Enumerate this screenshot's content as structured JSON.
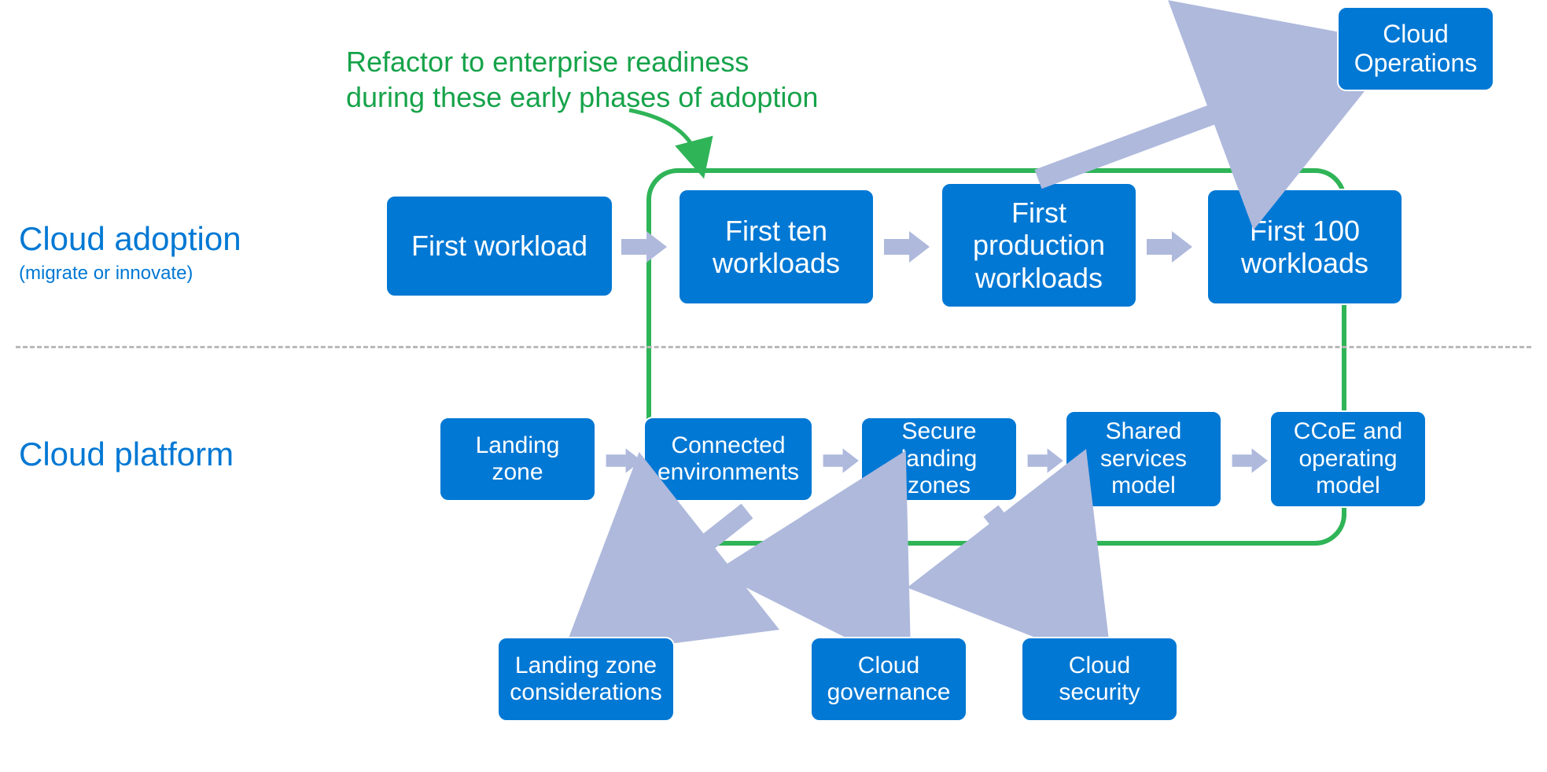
{
  "callout": {
    "line1": "Refactor to enterprise readiness",
    "line2": "during these early phases of adoption"
  },
  "rows": {
    "adoption": {
      "title": "Cloud adoption",
      "subtitle": "(migrate or innovate)",
      "boxes": {
        "b1": "First workload",
        "b2": "First ten workloads",
        "b3": "First production workloads",
        "b4": "First 100 workloads"
      }
    },
    "platform": {
      "title": "Cloud platform",
      "boxes": {
        "p1": "Landing zone",
        "p2": "Connected environments",
        "p3": "Secure landing zones",
        "p4": "Shared services model",
        "p5": "CCoE and operating model"
      }
    }
  },
  "detached": {
    "top": "Cloud Operations",
    "d1": "Landing zone considerations",
    "d2": "Cloud governance",
    "d3": "Cloud security"
  },
  "colors": {
    "box": "#0078d4",
    "highlight": "#2fb457",
    "arrow": "#aeb9dc",
    "text": "#0078d4"
  }
}
